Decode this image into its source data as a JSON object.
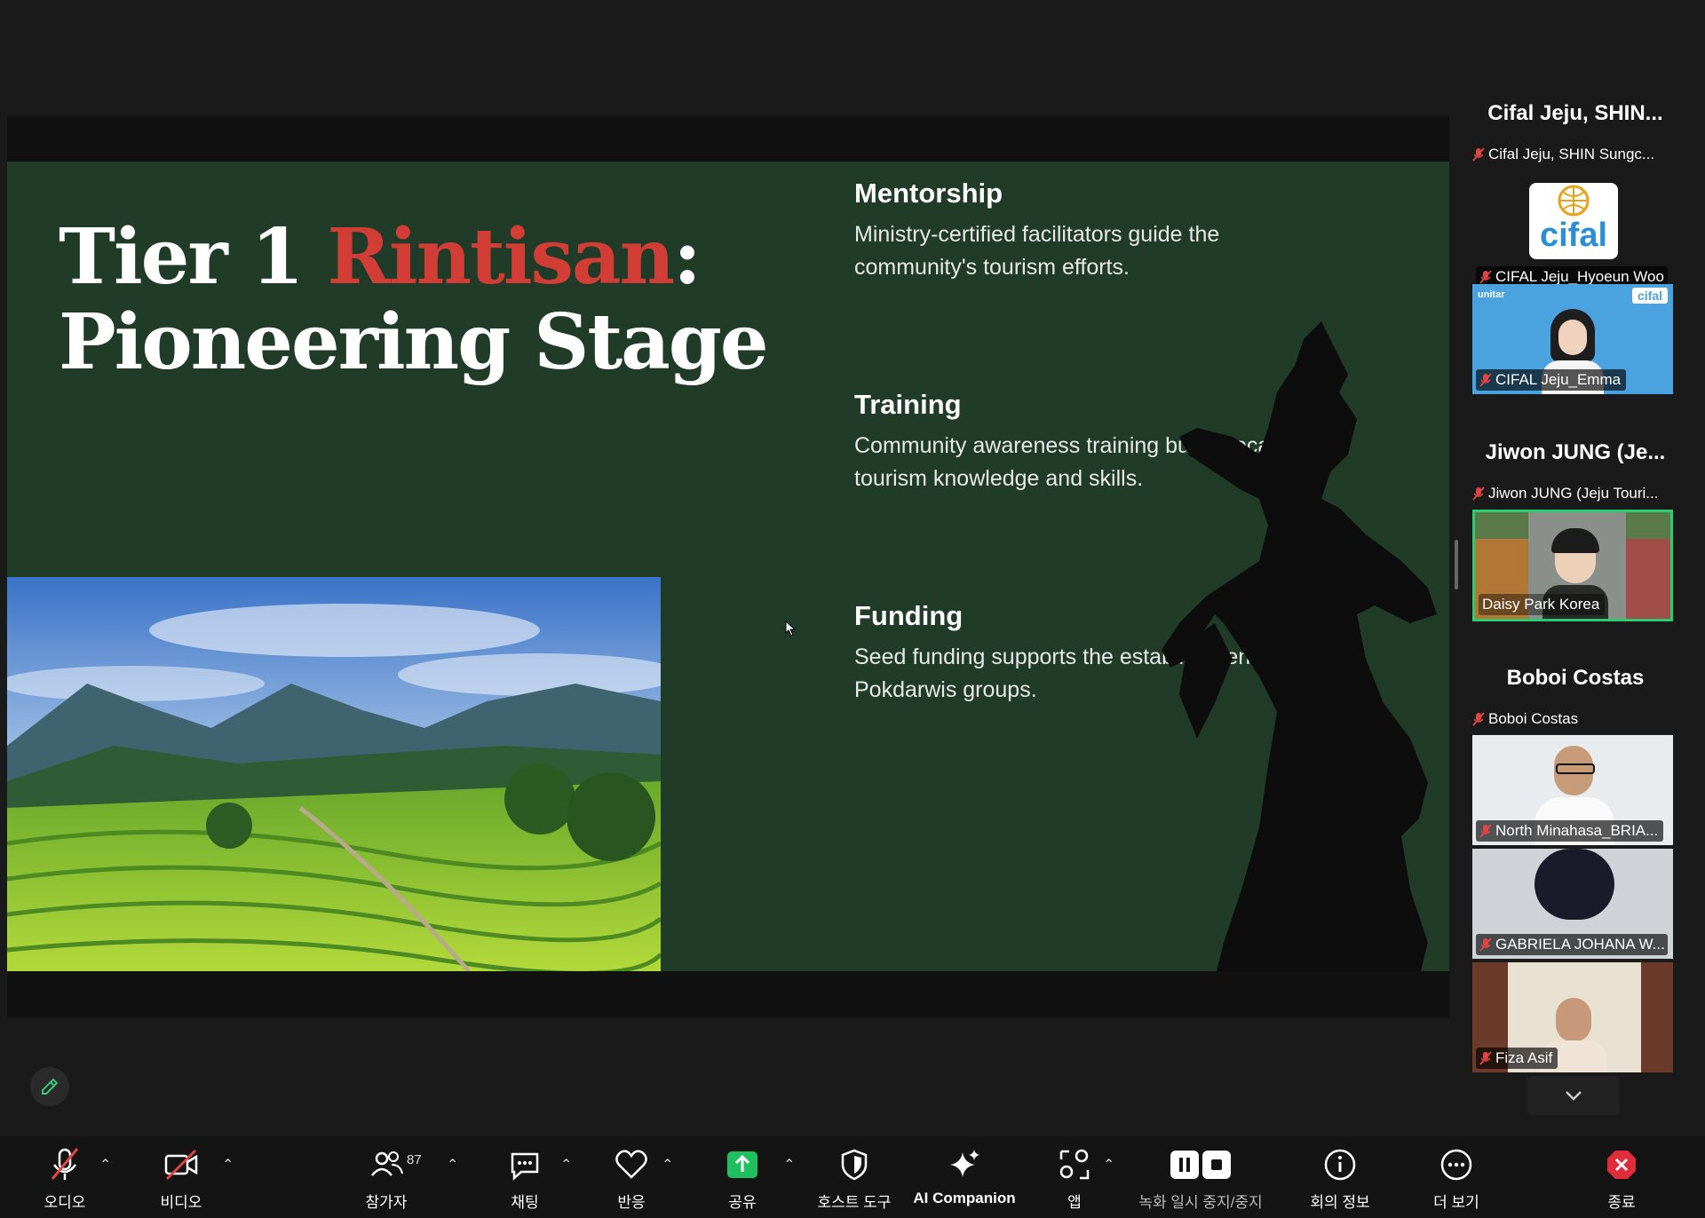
{
  "slide": {
    "title_prefix": "Tier 1 ",
    "title_highlight": "Rintisan",
    "title_colon": ":",
    "title_line2": "Pioneering Stage",
    "items": [
      {
        "heading": "Mentorship",
        "text": "Ministry-certified facilitators guide the community's tourism efforts."
      },
      {
        "heading": "Training",
        "text": "Community awareness training builds local tourism knowledge and skills."
      },
      {
        "heading": "Funding",
        "text": "Seed funding supports the establishment of Pokdarwis groups."
      }
    ],
    "colors": {
      "background": "#203b28",
      "accent": "#d23d36"
    }
  },
  "gallery": {
    "groups": [
      {
        "title": "Cifal Jeju, SHIN...",
        "name_row": "Cifal Jeju, SHIN Sungc...",
        "tiles": [
          {
            "label": "CIFAL Jeju_Hyoeun Woo",
            "logo": "cifal"
          },
          {
            "label": "CIFAL Jeju_Emma",
            "logo_top_left": "unitar",
            "logo_top_right": "cifal"
          }
        ]
      },
      {
        "title": "Jiwon JUNG (Je...",
        "name_row": "Jiwon JUNG (Jeju Touri...",
        "tiles": [
          {
            "label": "Daisy Park Korea"
          }
        ]
      },
      {
        "title": "Boboi Costas",
        "name_row": "Boboi Costas",
        "tiles": [
          {
            "label": "North Minahasa_BRIA..."
          },
          {
            "label": "GABRIELA JOHANA W..."
          },
          {
            "label": "Fiza Asif"
          }
        ]
      }
    ]
  },
  "toolbar": {
    "audio": "오디오",
    "video": "비디오",
    "participants": "참가자",
    "participants_count": "87",
    "chat": "채팅",
    "reactions": "반응",
    "share": "공유",
    "host_tools": "호스트 도구",
    "ai_companion": "AI Companion",
    "apps": "앱",
    "recording": "녹화 일시 중지/중지",
    "meeting_info": "회의 정보",
    "more": "더 보기",
    "end": "종료"
  }
}
